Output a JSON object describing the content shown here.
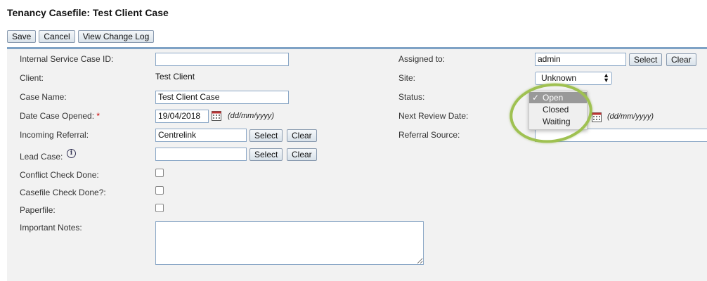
{
  "page": {
    "title": "Tenancy Casefile: Test Client Case"
  },
  "toolbar": {
    "save": "Save",
    "cancel": "Cancel",
    "view_log": "View Change Log"
  },
  "left": {
    "internal_id": {
      "label": "Internal Service Case ID:",
      "value": ""
    },
    "client": {
      "label": "Client:",
      "value": "Test Client"
    },
    "case_name": {
      "label": "Case Name:",
      "value": "Test Client Case"
    },
    "date_opened": {
      "label": "Date Case Opened:",
      "required": "*",
      "value": "19/04/2018",
      "hint": "(dd/mm/yyyy)"
    },
    "incoming_referral": {
      "label": "Incoming Referral:",
      "value": "Centrelink",
      "select": "Select",
      "clear": "Clear"
    },
    "lead_case": {
      "label": "Lead Case:",
      "info": "i",
      "value": "",
      "select": "Select",
      "clear": "Clear"
    },
    "conflict_check": {
      "label": "Conflict Check Done:"
    },
    "casefile_check": {
      "label": "Casefile Check Done?:"
    },
    "paperfile": {
      "label": "Paperfile:"
    },
    "important_notes": {
      "label": "Important Notes:"
    }
  },
  "right": {
    "assigned_to": {
      "label": "Assigned to:",
      "value": "admin",
      "select": "Select",
      "clear": "Clear"
    },
    "site": {
      "label": "Site:",
      "value": "Unknown"
    },
    "status": {
      "label": "Status:"
    },
    "next_review": {
      "label": "Next Review Date:",
      "hint": "(dd/mm/yyyy)"
    },
    "referral_source": {
      "label": "Referral Source:"
    }
  },
  "status_dropdown": {
    "options": [
      "Open",
      "Closed",
      "Waiting"
    ],
    "selected": "Open",
    "check": "✓"
  },
  "colors": {
    "accent": "#7ea2c5",
    "highlight_ring": "#9fc151",
    "required": "#cc0000"
  }
}
